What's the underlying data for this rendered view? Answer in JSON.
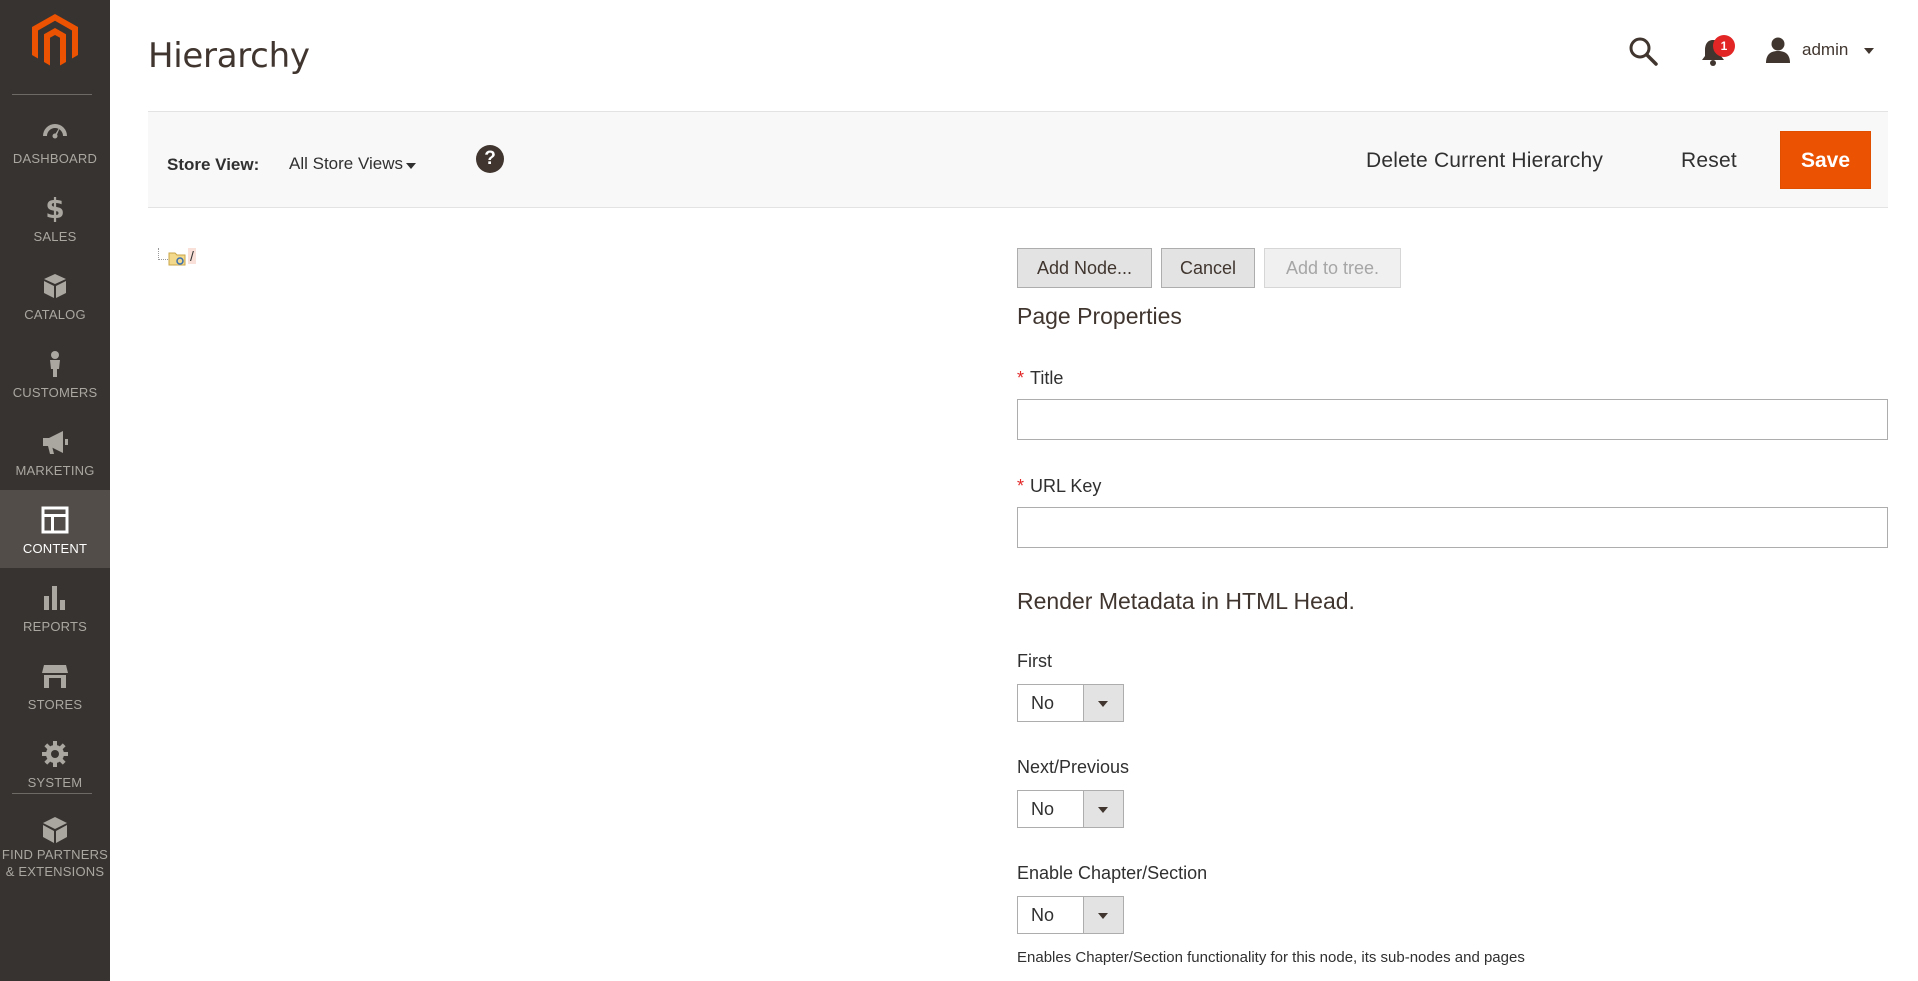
{
  "app": {
    "page_title": "Hierarchy"
  },
  "sidebar": {
    "items": [
      {
        "label": "DASHBOARD",
        "icon": "dashboard-icon"
      },
      {
        "label": "SALES",
        "icon": "dollar-icon"
      },
      {
        "label": "CATALOG",
        "icon": "cube-icon"
      },
      {
        "label": "CUSTOMERS",
        "icon": "person-icon"
      },
      {
        "label": "MARKETING",
        "icon": "megaphone-icon"
      },
      {
        "label": "CONTENT",
        "icon": "layout-icon",
        "active": true
      },
      {
        "label": "REPORTS",
        "icon": "bar-chart-icon"
      },
      {
        "label": "STORES",
        "icon": "storefront-icon"
      },
      {
        "label": "SYSTEM",
        "icon": "gear-icon"
      },
      {
        "label": "FIND PARTNERS & EXTENSIONS",
        "label_line1": "FIND PARTNERS",
        "label_line2": "& EXTENSIONS",
        "icon": "blocks-icon"
      }
    ]
  },
  "header": {
    "notification_count": "1",
    "user_name": "admin"
  },
  "toolbar": {
    "store_view_label": "Store View:",
    "store_view_value": "All Store Views",
    "delete_label": "Delete Current Hierarchy",
    "reset_label": "Reset",
    "save_label": "Save"
  },
  "tree": {
    "root_label": "/"
  },
  "node_actions": {
    "add_node": "Add Node...",
    "cancel": "Cancel",
    "add_to_tree": "Add to tree."
  },
  "form": {
    "page_properties_title": "Page Properties",
    "title_label": "Title",
    "title_value": "",
    "url_key_label": "URL Key",
    "url_key_value": "",
    "metadata_title": "Render Metadata in HTML Head.",
    "first_label": "First",
    "first_value": "No",
    "next_prev_label": "Next/Previous",
    "next_prev_value": "No",
    "chapter_label": "Enable Chapter/Section",
    "chapter_value": "No",
    "chapter_note": "Enables Chapter/Section functionality for this node, its sub-nodes and pages"
  },
  "colors": {
    "sidebar_bg": "#373330",
    "sidebar_active": "#524d49",
    "accent_orange": "#eb5202",
    "badge_red": "#e22626"
  }
}
